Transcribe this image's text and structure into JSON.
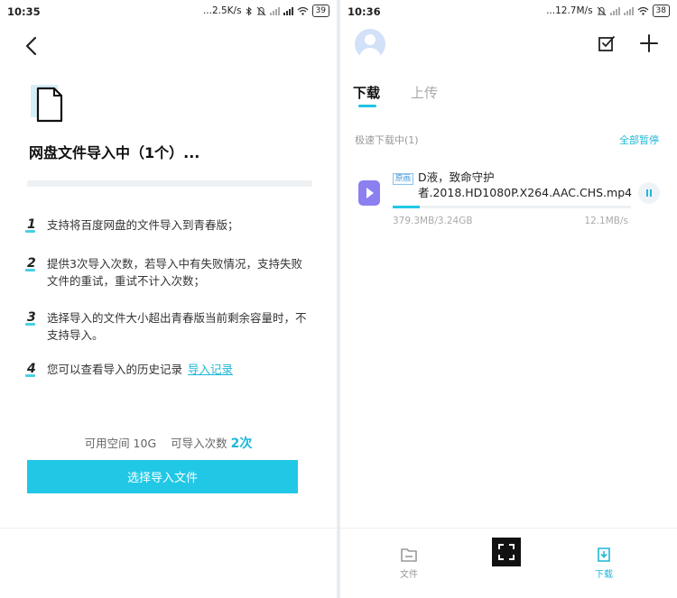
{
  "left": {
    "status": {
      "time": "10:35",
      "speed": "...2.5K/s",
      "battery": "39"
    },
    "title": "网盘文件导入中（1个）...",
    "rules": [
      {
        "num": "1",
        "text": "支持将百度网盘的文件导入到青春版；"
      },
      {
        "num": "2",
        "text": "提供3次导入次数，若导入中有失败情况，支持失败文件的重试，重试不计入次数；"
      },
      {
        "num": "3",
        "text": "选择导入的文件大小超出青春版当前剩余容量时，不支持导入。"
      },
      {
        "num": "4",
        "text": "您可以查看导入的历史记录",
        "link": "导入记录"
      }
    ],
    "space_label": "可用空间 10G",
    "count_label": "可导入次数",
    "count_value": "2次",
    "select_button": "选择导入文件"
  },
  "right": {
    "status": {
      "time": "10:36",
      "speed": "...12.7M/s",
      "battery": "38"
    },
    "tabs": {
      "download": "下载",
      "upload": "上传"
    },
    "section_label": "极速下载中(1)",
    "pause_all": "全部暂停",
    "file": {
      "tag": "原画",
      "name": "D液，致命守护者.2018.HD1080P.X264.AAC.CHS.mp4",
      "size": "379.3MB/3.24GB",
      "speed": "12.1MB/s",
      "progress": 0.114
    },
    "nav": {
      "files": "文件",
      "download": "下载"
    }
  },
  "colors": {
    "accent": "#20c8e6",
    "file_icon": "#8c7ff0"
  },
  "icons": [
    "back-arrow-icon",
    "document-icon",
    "edit-checkbox-icon",
    "plus-icon",
    "folder-icon",
    "scan-icon",
    "download-doc-icon",
    "bluetooth-icon",
    "wifi-icon",
    "battery-icon"
  ]
}
